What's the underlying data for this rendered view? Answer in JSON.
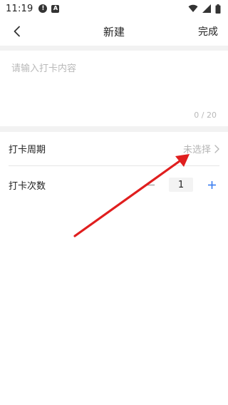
{
  "status_bar": {
    "time": "11:19",
    "alert_glyph": "!",
    "app_glyph": "A",
    "icons": [
      "alert-icon",
      "a-icon",
      "wifi-icon",
      "signal-icon",
      "battery-icon"
    ]
  },
  "nav": {
    "title": "新建",
    "done_label": "完成",
    "back_icon": "chevron-left-icon"
  },
  "content": {
    "placeholder": "请输入打卡内容",
    "value": "",
    "char_count": "0 / 20"
  },
  "period_row": {
    "label": "打卡周期",
    "value": "未选择",
    "icon": "chevron-right-icon"
  },
  "count_row": {
    "label": "打卡次数",
    "value": "1",
    "decrement_icon": "minus-icon",
    "increment_icon": "plus-icon"
  },
  "colors": {
    "accent": "#3a7df0",
    "annotation": "#e01e1e",
    "separator": "#f2f2f2",
    "placeholder": "#b9b9b9"
  }
}
